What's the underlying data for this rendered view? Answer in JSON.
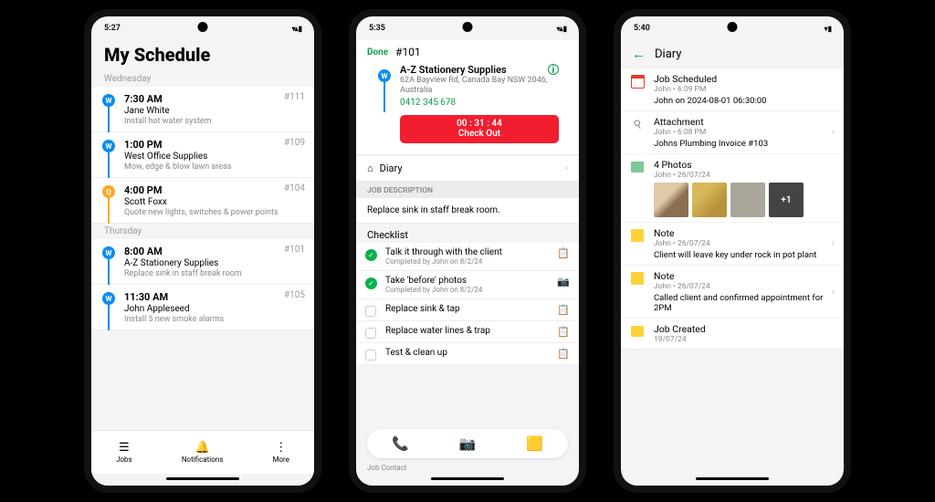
{
  "phone1": {
    "status_time": "5:27",
    "title": "My Schedule",
    "sections": [
      {
        "day": "Wednesday",
        "jobs": [
          {
            "marker": "W",
            "time": "7:30 AM",
            "id": "#111",
            "client": "Jane White",
            "desc": "Install hot water system"
          },
          {
            "marker": "W",
            "time": "1:00 PM",
            "id": "#109",
            "client": "West Office Supplies",
            "desc": "Mow, edge & blow lawn areas"
          },
          {
            "marker": "Q",
            "time": "4:00 PM",
            "id": "#104",
            "client": "Scott Foxx",
            "desc": "Quote new lights, switches & power points"
          }
        ]
      },
      {
        "day": "Thursday",
        "jobs": [
          {
            "marker": "W",
            "time": "8:00 AM",
            "id": "#101",
            "client": "A-Z Stationery Supplies",
            "desc": "Replace sink in staff break room"
          },
          {
            "marker": "W",
            "time": "11:30 AM",
            "id": "#105",
            "client": "John Appleseed",
            "desc": "Install 5 new smoke alarms"
          }
        ]
      }
    ],
    "tabs": [
      {
        "icon": "☰",
        "label": "Jobs"
      },
      {
        "icon": "🔔",
        "label": "Notifications"
      },
      {
        "icon": "⋮",
        "label": "More"
      }
    ]
  },
  "phone2": {
    "status_time": "5:35",
    "done_label": "Done",
    "job_number": "#101",
    "client_name": "A-Z Stationery Supplies",
    "client_addr": "62A Bayview Rd, Canada Bay NSW 2046, Australia",
    "client_phone": "0412 345 678",
    "checkout_time": "00 : 31 : 44",
    "checkout_label": "Check Out",
    "diary_link": "Diary",
    "jd_label": "JOB DESCRIPTION",
    "jd_text": "Replace sink in staff break room.",
    "checklist_label": "Checklist",
    "checklist": [
      {
        "done": true,
        "title": "Talk it through with the client",
        "sub": "Completed by John on 8/2/24",
        "emoji": "📋"
      },
      {
        "done": true,
        "title": "Take 'before' photos",
        "sub": "Completed by John on 8/2/24",
        "emoji": "📷"
      },
      {
        "done": false,
        "title": "Replace sink & tap",
        "sub": "",
        "emoji": "📋"
      },
      {
        "done": false,
        "title": "Replace water lines & trap",
        "sub": "",
        "emoji": "📋"
      },
      {
        "done": false,
        "title": "Test & clean up",
        "sub": "",
        "emoji": "📋"
      }
    ],
    "footer_label": "Job Contact"
  },
  "phone3": {
    "status_time": "5:40",
    "title": "Diary",
    "entries": [
      {
        "icon": "cal",
        "title": "Job Scheduled",
        "meta": "John • 6:09 PM",
        "body": "John on 2024-08-01 06:30:00",
        "chev": false
      },
      {
        "icon": "attach",
        "title": "Attachment",
        "meta": "John • 6:08 PM",
        "body": "Johns Plumbing Invoice #103",
        "chev": true
      },
      {
        "icon": "photos",
        "title": "4 Photos",
        "meta": "John • 26/07/24",
        "body": "",
        "photos": true,
        "more": "+1",
        "chev": false
      },
      {
        "icon": "note",
        "title": "Note",
        "meta": "John • 26/07/24",
        "body": "Client will leave key under rock in pot plant",
        "chev": true
      },
      {
        "icon": "note",
        "title": "Note",
        "meta": "John • 26/07/24",
        "body": "Called client and confirmed appointment for 2PM",
        "chev": true
      },
      {
        "icon": "folder",
        "title": "Job Created",
        "meta": "19/07/24",
        "body": "",
        "chev": false
      }
    ]
  }
}
